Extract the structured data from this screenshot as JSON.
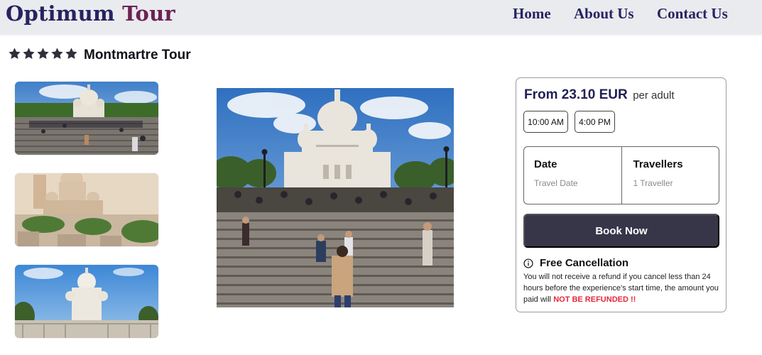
{
  "header": {
    "logo_word1": "Optimum",
    "logo_word2": "Tour",
    "nav": [
      "Home",
      "About Us",
      "Contact Us"
    ]
  },
  "tour": {
    "rating": 5,
    "rating_max": 5,
    "title": "Montmartre Tour"
  },
  "gallery": {
    "thumbnails": [
      "thumbnail-1",
      "thumbnail-2",
      "thumbnail-3"
    ],
    "main": "main-photo"
  },
  "booking": {
    "price": "From 23.10 EUR",
    "per": "per adult",
    "times": [
      "10:00 AM",
      "4:00 PM"
    ],
    "date_label": "Date",
    "date_placeholder": "Travel Date",
    "travellers_label": "Travellers",
    "travellers_value": "1 Traveller",
    "book_button": "Book Now",
    "cancellation_title": "Free Cancellation",
    "cancellation_text": "You will not receive a refund if you cancel less than 24 hours before the experience's start time, the amount you paid will ",
    "cancellation_warning": "NOT BE REFUNDED !!"
  },
  "colors": {
    "logo_primary": "#28235f",
    "logo_accent": "#6c2253",
    "header_bg": "#e9ebef",
    "button_bg": "#373548",
    "warning": "#e4283b",
    "star": "#2f2f3a"
  },
  "icons": {
    "rating": "star-icon",
    "info": "info-icon"
  }
}
